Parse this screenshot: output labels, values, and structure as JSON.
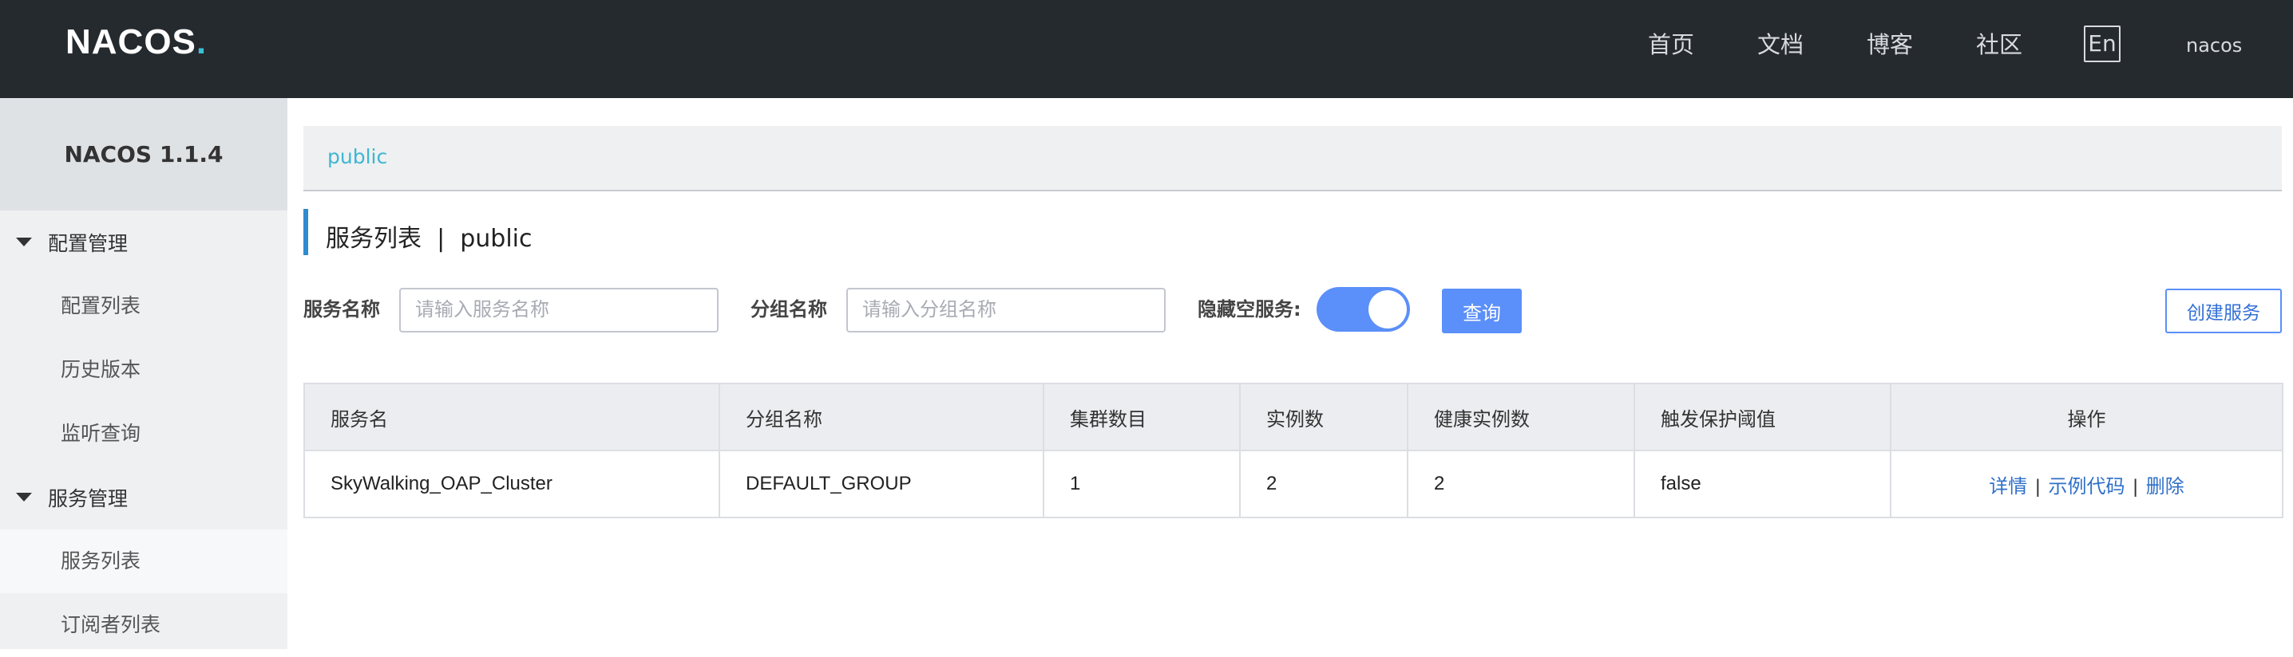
{
  "header": {
    "logo_text": "NACOS",
    "logo_dot": ".",
    "nav": [
      "首页",
      "文档",
      "博客",
      "社区"
    ],
    "lang_button": "En",
    "user": "nacos"
  },
  "sidebar": {
    "version": "NACOS 1.1.4",
    "groups": [
      {
        "label": "配置管理",
        "items": [
          "配置列表",
          "历史版本",
          "监听查询"
        ]
      },
      {
        "label": "服务管理",
        "items": [
          "服务列表",
          "订阅者列表"
        ]
      }
    ]
  },
  "breadcrumb": {
    "namespace": "public"
  },
  "page": {
    "title": "服务列表  |  public"
  },
  "filters": {
    "service_name_label": "服务名称",
    "service_name_placeholder": "请输入服务名称",
    "group_name_label": "分组名称",
    "group_name_placeholder": "请输入分组名称",
    "hide_empty_label": "隐藏空服务:",
    "hide_empty_on": true,
    "query_button": "查询",
    "create_button": "创建服务"
  },
  "table": {
    "columns": [
      "服务名",
      "分组名称",
      "集群数目",
      "实例数",
      "健康实例数",
      "触发保护阈值",
      "操作"
    ],
    "rows": [
      {
        "service_name": "SkyWalking_OAP_Cluster",
        "group_name": "DEFAULT_GROUP",
        "cluster_count": "1",
        "instance_count": "2",
        "healthy_instance_count": "2",
        "protect_threshold": "false",
        "actions": [
          "详情",
          "示例代码",
          "删除"
        ]
      }
    ]
  },
  "colors": {
    "header_bg": "#252a2f",
    "accent": "#5b8ff9",
    "breadcrumb_link": "#3fb6d2",
    "link": "#2f6fc8"
  }
}
